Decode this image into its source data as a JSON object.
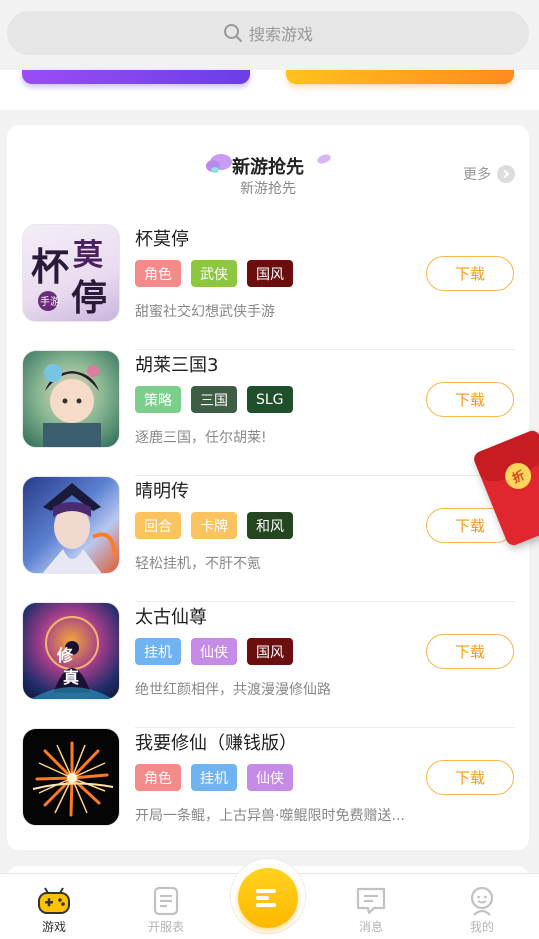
{
  "search": {
    "placeholder": "搜索游戏"
  },
  "section": {
    "title": "新游抢先",
    "subtitle": "新游抢先",
    "more_label": "更多"
  },
  "colors": {
    "accent": "#f49a1c",
    "tab_active": "#ffc200"
  },
  "games": [
    {
      "name": "杯莫停",
      "desc": "甜蜜社交幻想武侠手游",
      "tags": [
        {
          "label": "角色",
          "color": "#f48b8b"
        },
        {
          "label": "武侠",
          "color": "#8dc63f"
        },
        {
          "label": "国风",
          "color": "#6b0e0e"
        }
      ],
      "download_label": "下载",
      "icon_text": "杯莫停",
      "icon_sub": "手游"
    },
    {
      "name": "胡莱三国3",
      "desc": "逐鹿三国，任尔胡莱!",
      "tags": [
        {
          "label": "策略",
          "color": "#7ccf8a"
        },
        {
          "label": "三国",
          "color": "#3f5c45"
        },
        {
          "label": "SLG",
          "color": "#1f4f2b"
        }
      ],
      "download_label": "下载"
    },
    {
      "name": "晴明传",
      "desc": "轻松挂机，不肝不氪",
      "tags": [
        {
          "label": "回合",
          "color": "#fbc35e"
        },
        {
          "label": "卡牌",
          "color": "#fbc35e"
        },
        {
          "label": "和风",
          "color": "#24451f"
        }
      ],
      "download_label": "下载"
    },
    {
      "name": "太古仙尊",
      "desc": "绝世红颜相伴，共渡漫漫修仙路",
      "tags": [
        {
          "label": "挂机",
          "color": "#6fb3f0"
        },
        {
          "label": "仙侠",
          "color": "#c58be6"
        },
        {
          "label": "国风",
          "color": "#6b0e0e"
        }
      ],
      "download_label": "下载",
      "icon_text": "修真"
    },
    {
      "name": "我要修仙（赚钱版）",
      "desc": "开局一条鲲，上古异兽·噬鲲限时免费赠送...",
      "tags": [
        {
          "label": "角色",
          "color": "#f48b8b"
        },
        {
          "label": "挂机",
          "color": "#6fb3f0"
        },
        {
          "label": "仙侠",
          "color": "#c58be6"
        }
      ],
      "download_label": "下载"
    }
  ],
  "redpacket": {
    "label": "折"
  },
  "tabbar": [
    {
      "label": "游戏",
      "icon": "gamepad-icon",
      "active": true
    },
    {
      "label": "开服表",
      "icon": "list-icon",
      "active": false
    },
    {
      "label": "",
      "icon": "menu-icon",
      "active": false
    },
    {
      "label": "消息",
      "icon": "message-icon",
      "active": false
    },
    {
      "label": "我的",
      "icon": "user-icon",
      "active": false
    }
  ]
}
